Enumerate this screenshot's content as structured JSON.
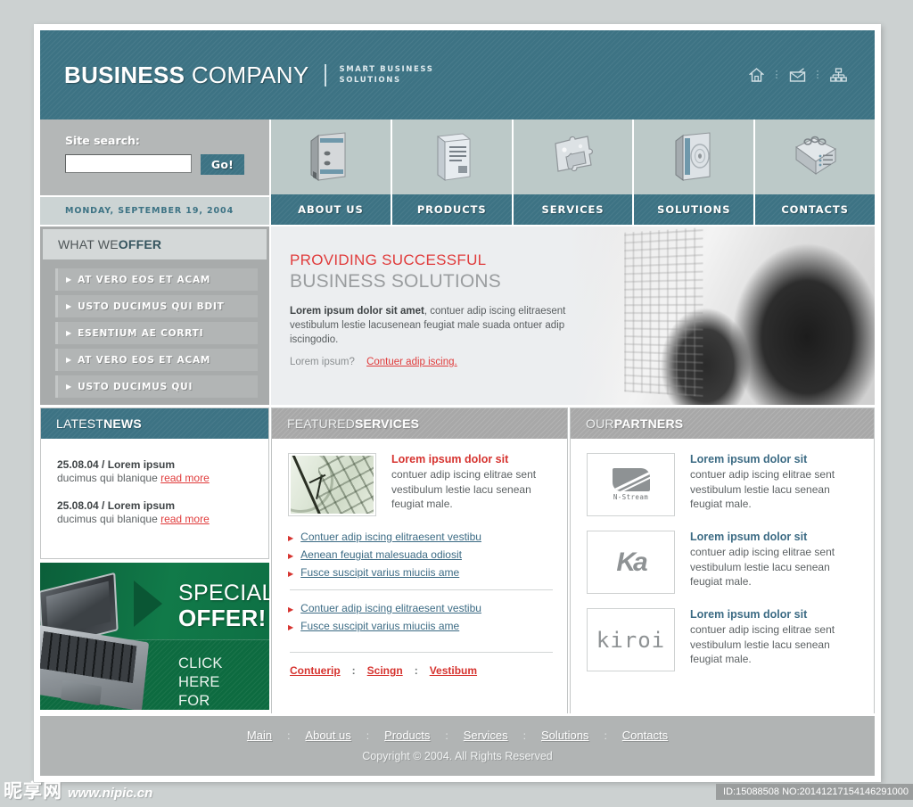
{
  "site": {
    "logo_bold": "BUSINESS",
    "logo_light": " COMPANY",
    "tagline_line1": "SMART BUSINESS",
    "tagline_line2": "SOLUTIONS"
  },
  "header_icons": [
    {
      "name": "home-icon",
      "sep": "⋮"
    },
    {
      "name": "mail-icon",
      "sep": "⋮"
    },
    {
      "name": "sitemap-icon",
      "sep": ""
    }
  ],
  "search": {
    "label": "Site search:",
    "value": "",
    "placeholder": "",
    "button_label": "Go!"
  },
  "date_bar": {
    "text": "MONDAY, SEPTEMBER 19, 2004"
  },
  "nav": {
    "items": [
      {
        "label": "ABOUT US",
        "icon": "binder-icon"
      },
      {
        "label": "PRODUCTS",
        "icon": "document-icon"
      },
      {
        "label": "SERVICES",
        "icon": "puzzle-icon"
      },
      {
        "label": "SOLUTIONS",
        "icon": "cd-case-icon"
      },
      {
        "label": "CONTACTS",
        "icon": "notepad-icon"
      }
    ]
  },
  "offer_panel": {
    "title_light": "WHAT WE ",
    "title_bold": "OFFER",
    "items": [
      "AT VERO EOS ET ACAM",
      "USTO DUCIMUS QUI BDIT",
      "ESENTIUM AE CORRTI",
      "AT VERO EOS ET ACAM",
      "USTO DUCIMUS QUI"
    ]
  },
  "hero": {
    "line1": "PROVIDING  SUCCESSFUL",
    "line2": "BUSINESS SOLUTIONS",
    "para_bold": "Lorem ipsum dolor sit amet",
    "para_rest": ", contuer adip iscing elitraesent vestibulum lestie lacusenean  feugiat male suada ontuer adip iscingodio.",
    "question": "Lorem ipsum?",
    "link": "Contuer adip iscing."
  },
  "news_panel": {
    "title_light": "LATEST ",
    "title_bold": "NEWS",
    "items": [
      {
        "title": "25.08.04 / Lorem ipsum",
        "desc": "ducimus qui blanique ",
        "link": "read more"
      },
      {
        "title": "25.08.04 / Lorem ipsum",
        "desc": "ducimus qui blanique ",
        "link": "read more"
      }
    ]
  },
  "special_offer": {
    "line1": "SPECIAL",
    "line2": "OFFER!",
    "line3": "CLICK HERE\nFOR DETAILS",
    "image": "laptop-photo"
  },
  "featured_panel": {
    "title_light": "FEATURED ",
    "title_bold": "SERVICES",
    "thumb": "clock-calculator-photo",
    "feature_title": "Lorem ipsum dolor sit",
    "feature_desc": "contuer adip iscing elitrae sent vestibulum lestie lacu senean  feugiat male.",
    "links_group1": [
      "Contuer adip iscing elitraesent vestibu",
      "Aenean  feugiat malesuada odiosit",
      "Fusce suscipit varius miuciis ame"
    ],
    "links_group2": [
      "Contuer adip iscing elitraesent vestibu",
      "Fusce suscipit varius miuciis ame"
    ],
    "bottom_links": [
      "Contuerip",
      "Scingn",
      "Vestibum"
    ],
    "bottom_sep": ":"
  },
  "partners_panel": {
    "title_light": "OUR ",
    "title_bold": "PARTNERS",
    "items": [
      {
        "logo": "n-stream-logo",
        "logo_text": "N-Stream",
        "title": "Lorem ipsum dolor sit",
        "desc": "contuer adip iscing elitrae sent vestibulum lestie lacu senean  feugiat male."
      },
      {
        "logo": "ka-logo",
        "logo_text": "Ka",
        "title": "Lorem ipsum dolor sit",
        "desc": "contuer adip iscing elitrae sent vestibulum lestie lacu senean  feugiat male."
      },
      {
        "logo": "kiroi-logo",
        "logo_text": "kiroi",
        "title": "Lorem ipsum dolor sit",
        "desc": "contuer adip iscing elitrae sent vestibulum lestie lacu senean  feugiat male."
      }
    ]
  },
  "footer": {
    "links": [
      "Main",
      "About us",
      "Products",
      "Services",
      "Solutions",
      "Contacts"
    ],
    "separator": ":",
    "copyright": "Copyright © 2004. All Rights Reserved"
  },
  "watermark": {
    "cn": "昵享网",
    "url": "www.nipic.cn",
    "id_text": "ID:15088508 NO:20141217154146291000"
  },
  "colors": {
    "teal": "#3d7384",
    "page_bg": "#ccd1d1",
    "accent_red": "#d6332f",
    "link_blue": "#3c6b84",
    "green": "#0f7346",
    "gray_panel": "#a8a8a8"
  }
}
